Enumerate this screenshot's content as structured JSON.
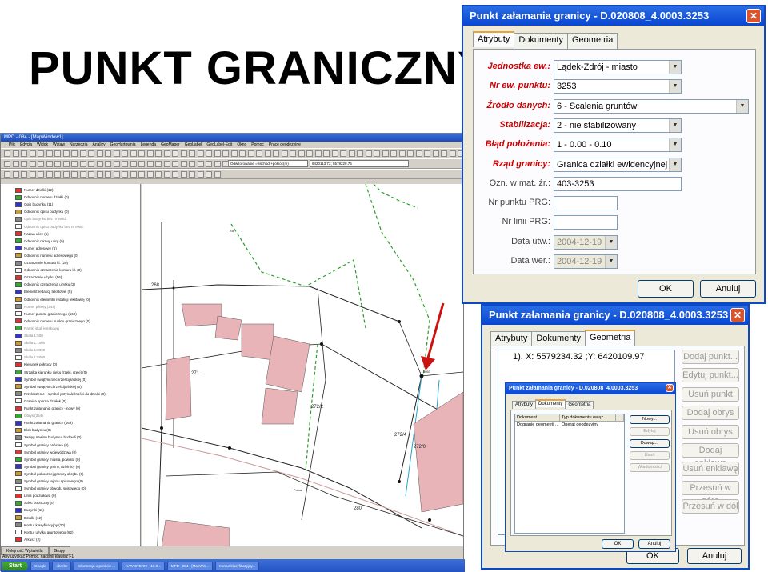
{
  "slide_title": "PUNKT GRANICZNY",
  "app": {
    "title": "MPD - 084 - [MapWindow1]",
    "menu": [
      "Plik",
      "Edycja",
      "Widok",
      "Wstaw",
      "Narzędzia",
      "Analizy",
      "GeoHurtownia",
      "Legenda",
      "GeoMaper",
      "GeoLabel",
      "GeoLabel-Edit",
      "Okno",
      "Pomoc",
      "Prace geodezyjne"
    ],
    "combo1": "Odwzorowanie =wschód,+północ(m)",
    "combo2": "6420113.72; 5579229.76",
    "layers": [
      {
        "label": "Numer działki (12)",
        "grey": false
      },
      {
        "label": "Odnośnik numeru działki (0)",
        "grey": false
      },
      {
        "label": "Opis budynku (11)",
        "grey": false
      },
      {
        "label": "Odnośnik opisu budynku (0)",
        "grey": false
      },
      {
        "label": "Opis budynku bez nr ewid.",
        "grey": true
      },
      {
        "label": "Odnośnik opisu budynku bez nr ewid.",
        "grey": true
      },
      {
        "label": "Nazwa ulicy (1)",
        "grey": false
      },
      {
        "label": "Odnośnik nazwy ulicy (0)",
        "grey": false
      },
      {
        "label": "Numer adresowy (5)",
        "grey": false
      },
      {
        "label": "Odnośnik numeru adresowego (0)",
        "grey": false
      },
      {
        "label": "Oznaczenie konturu kl. (20)",
        "grey": false
      },
      {
        "label": "Odnośnik oznaczenia konturu kl. (0)",
        "grey": false
      },
      {
        "label": "Oznaczenie użytku (56)",
        "grey": false
      },
      {
        "label": "Odnośnik oznaczenia użytku (2)",
        "grey": false
      },
      {
        "label": "Element redakcji tekstowej (5)",
        "grey": false
      },
      {
        "label": "Odnośnik elementu redakcji tekstowej (0)",
        "grey": false
      },
      {
        "label": "Numer pikiety (244)",
        "grey": true
      },
      {
        "label": "Numer punktu granicznego (169)",
        "grey": false
      },
      {
        "label": "Odnośnik numeru punktu granicznego (0)",
        "grey": false
      },
      {
        "label": "Ramki skali kreskowej",
        "grey": true
      },
      {
        "label": "Skala 1:500",
        "grey": true
      },
      {
        "label": "Skala 1:1000",
        "grey": true
      },
      {
        "label": "Skala 1:2000",
        "grey": true
      },
      {
        "label": "Skala 1:5000",
        "grey": true
      },
      {
        "label": "Kierunek północy (0)",
        "grey": false
      },
      {
        "label": "Strzałka kierunku cieku (rzeki, rzeki) (0)",
        "grey": false
      },
      {
        "label": "Symbol świątyni niechrześcijańskiej (0)",
        "grey": false
      },
      {
        "label": "Symbol świątyni chrześcijańskiej (0)",
        "grey": false
      },
      {
        "label": "Przełączenie - symbol przynależności do działki (0)",
        "grey": false
      },
      {
        "label": "Granica sporna działek (0)",
        "grey": false
      },
      {
        "label": "Punkt załamania granicy - nowy (0)",
        "grey": false
      },
      {
        "label": "Obrys (254)",
        "grey": true
      },
      {
        "label": "Punkt załamania granicy (169)",
        "grey": false
      },
      {
        "label": "Blok budynku (0)",
        "grey": false
      },
      {
        "label": "Zasięg nawisu budynku, budowli (0)",
        "grey": false
      },
      {
        "label": "Symbol granicy państwa (0)",
        "grey": false
      },
      {
        "label": "Symbol granicy województwa (0)",
        "grey": false
      },
      {
        "label": "Symbol granicy miasta, powiatu (0)",
        "grey": false
      },
      {
        "label": "Symbol granicy gminy, dzielnicy (0)",
        "grey": false
      },
      {
        "label": "Symbol pobocznej granicy obrębu (0)",
        "grey": false
      },
      {
        "label": "Symbol granicy rejonu spisowego (0)",
        "grey": false
      },
      {
        "label": "Symbol granicy obwodu spisowego (0)",
        "grey": false
      },
      {
        "label": "Linia podziałowa (0)",
        "grey": false
      },
      {
        "label": "Szkic poboczny (0)",
        "grey": false
      },
      {
        "label": "Budynki (11)",
        "grey": false
      },
      {
        "label": "Działki (12)",
        "grey": false
      },
      {
        "label": "Kontur klasyfikacyjny (20)",
        "grey": false
      },
      {
        "label": "Kontur użytku gruntowego (62)",
        "grey": false
      },
      {
        "label": "Arkusz (2)",
        "grey": false
      }
    ],
    "panel_tabs": [
      "Kolejność Wyświetla",
      "Grupy"
    ],
    "status": "Aby uzyskać Pomoc, naciśnij klawisz F1",
    "map_labels": [
      "268",
      "271",
      "272/2",
      "272/4",
      "272/0",
      "280",
      "3053",
      "Polna",
      "ZB"
    ]
  },
  "taskbar": {
    "start": "Start",
    "items": [
      "Google",
      "obrebe",
      "Informacja o punkcie ...",
      "KATASTERKI - 10.0...",
      "MPD - 084 - [MapWin...",
      "Kontur klasyfikacyjny..."
    ]
  },
  "dlg1": {
    "title": "Punkt załamania granicy - D.020808_4.0003.3253",
    "tabs": [
      "Atrybuty",
      "Dokumenty",
      "Geometria"
    ],
    "fields": [
      {
        "label": "Jednostka ew.:",
        "value": "Lądek-Zdrój - miasto",
        "required": true,
        "dropdown": true,
        "disabled": false
      },
      {
        "label": "Nr ew. punktu:",
        "value": "3253",
        "required": true,
        "dropdown": true,
        "disabled": false
      },
      {
        "label": "Źródło danych:",
        "value": "6 - Scalenia gruntów",
        "required": true,
        "dropdown": true,
        "disabled": false
      },
      {
        "label": "Stabilizacja:",
        "value": "2 - nie stabilizowany",
        "required": true,
        "dropdown": true,
        "disabled": false
      },
      {
        "label": "Błąd położenia:",
        "value": "1 - 0.00 - 0.10",
        "required": true,
        "dropdown": true,
        "disabled": false
      },
      {
        "label": "Rząd granicy:",
        "value": "Granica działki ewidencyjnej",
        "required": true,
        "dropdown": true,
        "disabled": false
      },
      {
        "label": "Ozn. w mat. źr.:",
        "value": "403-3253",
        "required": false,
        "dropdown": false,
        "disabled": false
      },
      {
        "label": "Nr punktu PRG:",
        "value": "",
        "required": false,
        "dropdown": false,
        "disabled": false
      },
      {
        "label": "Nr linii PRG:",
        "value": "",
        "required": false,
        "dropdown": false,
        "disabled": false
      },
      {
        "label": "Data utw.:",
        "value": "2004-12-19",
        "required": false,
        "dropdown": true,
        "disabled": true
      },
      {
        "label": "Data wer.:",
        "value": "2004-12-19",
        "required": false,
        "dropdown": true,
        "disabled": true
      }
    ],
    "ok": "OK",
    "cancel": "Anuluj"
  },
  "dlg2": {
    "title": "Punkt załamania granicy - D.020808_4.0003.3253",
    "tabs": [
      "Atrybuty",
      "Dokumenty",
      "Geometria"
    ],
    "coord": "1). X: 5579234.32 ;Y: 6420109.97",
    "buttons": [
      "Dodaj punkt...",
      "Edytuj punkt...",
      "Usuń punkt",
      "Dodaj obrys",
      "Usuń obrys",
      "Dodaj enklawę",
      "Usuń enklawę",
      "Przesuń w górę",
      "Przesuń w dół"
    ],
    "ok": "OK",
    "cancel": "Anuluj"
  },
  "dlg3": {
    "title": "Punkt załamania granicy - D.020808_4.0003.3253",
    "tabs": [
      "Atrybuty",
      "Dokumenty",
      "Geometria"
    ],
    "columns": [
      "Dokument",
      "Typ dokumentu (wiąz...",
      "I"
    ],
    "rows": [
      [
        "Dogranie geometrii ...",
        "Operat geodezyjny",
        "I"
      ]
    ],
    "buttons": [
      "Nowy...",
      "Edytuj",
      "Dowiąż...",
      "Usuń",
      "Wiadomości"
    ],
    "ok": "OK",
    "cancel": "Anuluj"
  }
}
